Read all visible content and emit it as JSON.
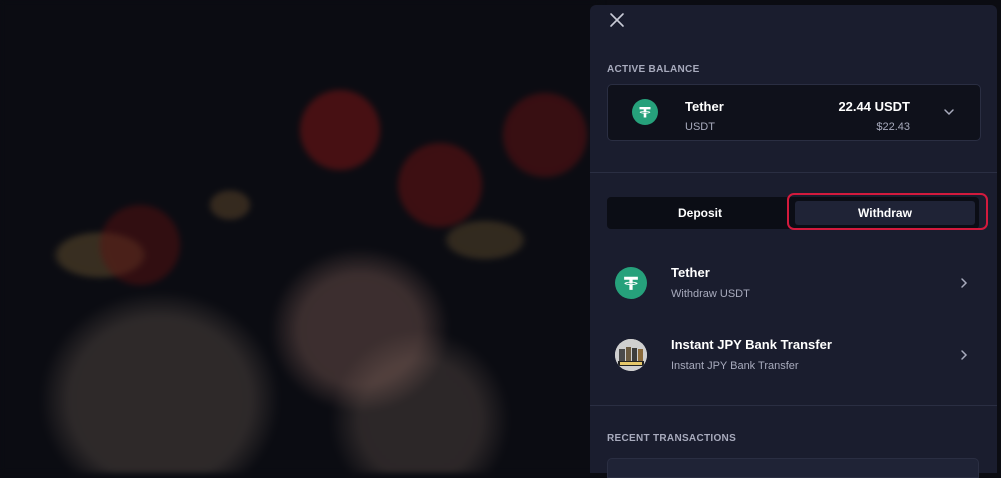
{
  "wallet": {
    "active_balance_label": "ACTIVE BALANCE",
    "balance": {
      "name": "Tether",
      "code": "USDT",
      "amount": "22.44 USDT",
      "usd_value": "$22.43"
    },
    "tabs": {
      "deposit": "Deposit",
      "withdraw": "Withdraw",
      "active": "Withdraw"
    },
    "methods": [
      {
        "title": "Tether",
        "subtitle": "Withdraw USDT",
        "icon": "tether-icon"
      },
      {
        "title": "Instant JPY Bank Transfer",
        "subtitle": "Instant JPY Bank Transfer",
        "icon": "bank-transfer-logo"
      }
    ],
    "recent_transactions_label": "RECENT TRANSACTIONS"
  },
  "colors": {
    "panel_bg": "#1a1d2e",
    "card_bg": "#0f111b",
    "tether_green": "#26a17b",
    "highlight_red": "#d31a3d",
    "muted_text": "#a8abbd"
  }
}
